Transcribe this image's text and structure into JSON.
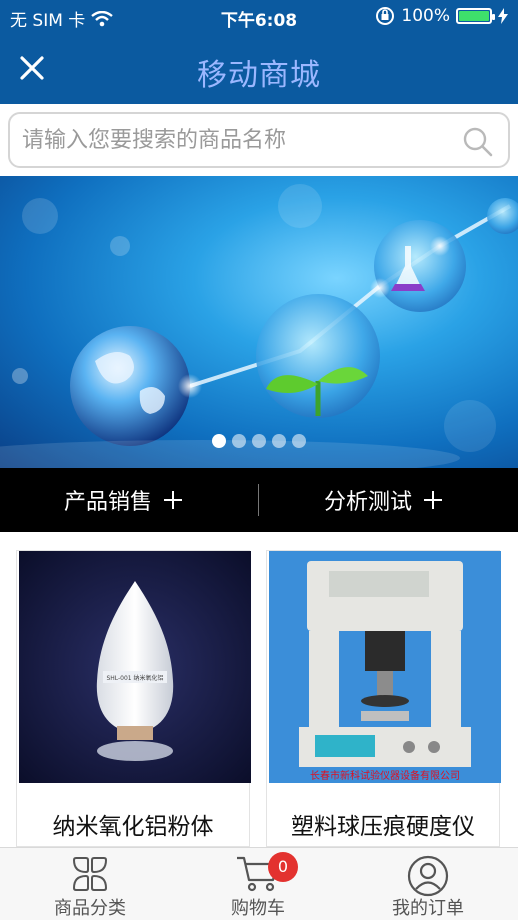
{
  "status_bar": {
    "carrier": "无 SIM 卡",
    "time": "下午6:08",
    "battery_percent": "100%",
    "battery_level": 1.0
  },
  "nav": {
    "title": "移动商城",
    "close_icon": "close-icon"
  },
  "search": {
    "placeholder": "请输入您要搜索的商品名称",
    "value": "",
    "icon": "search-icon"
  },
  "banner": {
    "slide_count": 5,
    "active_slide": 1
  },
  "categories": [
    {
      "label": "产品销售",
      "icon": "plus-icon"
    },
    {
      "label": "分析测试",
      "icon": "plus-icon"
    }
  ],
  "products": [
    {
      "name": "纳米氧化铝粉体",
      "image_label": "SHL-001 纳米氧化铝",
      "icon": "powder-bottle-image"
    },
    {
      "name": "塑料球压痕硬度仪",
      "image_label": "长春市新科试验仪器设备有限公司",
      "icon": "hardness-tester-image"
    }
  ],
  "tabbar": {
    "items": [
      {
        "label": "商品分类",
        "icon": "category-grid-icon"
      },
      {
        "label": "购物车",
        "icon": "cart-icon",
        "badge": "0"
      },
      {
        "label": "我的订单",
        "icon": "user-orders-icon"
      }
    ]
  },
  "colors": {
    "header_bg": "#0b5aa0",
    "title_color": "#9bb7ff",
    "category_bar_bg": "#000000",
    "badge": "#e3322f"
  }
}
